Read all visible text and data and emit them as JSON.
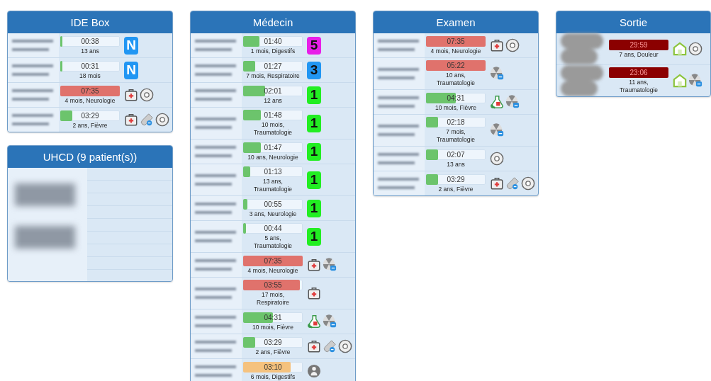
{
  "columns": [
    {
      "panels": [
        {
          "title": "IDE Box",
          "kind": "list",
          "rows": [
            {
              "name": {
                "kind": "blur"
              },
              "timer": {
                "text": "00:38",
                "level": 0.04,
                "color": "#6cc46c"
              },
              "detail": "13 ans",
              "badge": {
                "text": "N",
                "kind": "letter",
                "color": "#2196f3"
              }
            },
            {
              "name": {
                "kind": "blur"
              },
              "timer": {
                "text": "00:31",
                "level": 0.04,
                "color": "#6cc46c"
              },
              "detail": "18 mois",
              "badge": {
                "text": "N",
                "kind": "letter",
                "color": "#2196f3"
              }
            },
            {
              "name": {
                "kind": "blur"
              },
              "timer": {
                "text": "07:35",
                "level": 1,
                "color": "#e0726c"
              },
              "detail": "4 mois, Neurologie",
              "icons": [
                {
                  "kind": "kit"
                },
                {
                  "kind": "disc"
                }
              ]
            },
            {
              "name": {
                "kind": "blur"
              },
              "timer": {
                "text": "03:29",
                "level": 0.2,
                "color": "#6cc46c"
              },
              "detail": "2 ans, Fièvre",
              "icons": [
                {
                  "kind": "kit"
                },
                {
                  "kind": "vial"
                },
                {
                  "kind": "disc"
                }
              ]
            }
          ]
        },
        {
          "title": "UHCD (9 patient(s))",
          "kind": "summary"
        }
      ]
    },
    {
      "panels": [
        {
          "title": "Médecin",
          "kind": "list",
          "rows": [
            {
              "name": {
                "kind": "blur"
              },
              "timer": {
                "text": "01:40",
                "level": 0.27,
                "color": "#6cc46c"
              },
              "detail": "1 mois, Digestifs",
              "badge": {
                "text": "5",
                "kind": "number",
                "color": "#e81ee8"
              }
            },
            {
              "name": {
                "kind": "blur"
              },
              "timer": {
                "text": "01:27",
                "level": 0.2,
                "color": "#6cc46c"
              },
              "detail": "7 mois, Respiratoire",
              "badge": {
                "text": "3",
                "kind": "number",
                "color": "#2196f3"
              }
            },
            {
              "name": {
                "kind": "blur"
              },
              "timer": {
                "text": "02:01",
                "level": 0.37,
                "color": "#6cc46c"
              },
              "detail": "12 ans",
              "badge": {
                "text": "1",
                "kind": "number",
                "color": "#22ee22"
              }
            },
            {
              "name": {
                "kind": "blur"
              },
              "timer": {
                "text": "01:48",
                "level": 0.3,
                "color": "#6cc46c"
              },
              "detail": "10 mois, Traumatologie",
              "badge": {
                "text": "1",
                "kind": "number",
                "color": "#22ee22"
              }
            },
            {
              "name": {
                "kind": "blur"
              },
              "timer": {
                "text": "01:47",
                "level": 0.3,
                "color": "#6cc46c"
              },
              "detail": "10 ans, Neurologie",
              "badge": {
                "text": "1",
                "kind": "number",
                "color": "#22ee22"
              }
            },
            {
              "name": {
                "kind": "blur"
              },
              "timer": {
                "text": "01:13",
                "level": 0.12,
                "color": "#6cc46c"
              },
              "detail": "13 ans, Traumatologie",
              "badge": {
                "text": "1",
                "kind": "number",
                "color": "#22ee22"
              }
            },
            {
              "name": {
                "kind": "blur"
              },
              "timer": {
                "text": "00:55",
                "level": 0.07,
                "color": "#6cc46c"
              },
              "detail": "3 ans, Neurologie",
              "badge": {
                "text": "1",
                "kind": "number",
                "color": "#22ee22"
              }
            },
            {
              "name": {
                "kind": "blur"
              },
              "timer": {
                "text": "00:44",
                "level": 0.05,
                "color": "#6cc46c"
              },
              "detail": "5 ans, Traumatologie",
              "badge": {
                "text": "1",
                "kind": "number",
                "color": "#22ee22"
              }
            },
            {
              "name": {
                "kind": "blur"
              },
              "timer": {
                "text": "07:35",
                "level": 1,
                "color": "#e0726c"
              },
              "detail": "4 mois, Neurologie",
              "icons": [
                {
                  "kind": "kit"
                },
                {
                  "kind": "radiation"
                }
              ]
            },
            {
              "name": {
                "kind": "blur"
              },
              "timer": {
                "text": "03:55",
                "level": 0.95,
                "color": "#e0726c"
              },
              "detail": "17 mois, Respiratoire",
              "icons": [
                {
                  "kind": "kit"
                }
              ]
            },
            {
              "name": {
                "kind": "blur"
              },
              "timer": {
                "text": "04:31",
                "level": 0.5,
                "color": "#6cc46c"
              },
              "detail": "10 mois, Fièvre",
              "icons": [
                {
                  "kind": "rx"
                },
                {
                  "kind": "radiation"
                }
              ]
            },
            {
              "name": {
                "kind": "blur"
              },
              "timer": {
                "text": "03:29",
                "level": 0.2,
                "color": "#6cc46c"
              },
              "detail": "2 ans, Fièvre",
              "icons": [
                {
                  "kind": "kit"
                },
                {
                  "kind": "vial"
                },
                {
                  "kind": "disc"
                }
              ]
            },
            {
              "name": {
                "kind": "blur"
              },
              "timer": {
                "text": "03:10",
                "level": 0.8,
                "color": "#f5c27e"
              },
              "detail": "6 mois, Digestifs",
              "icons": [
                {
                  "kind": "person"
                }
              ]
            }
          ]
        }
      ]
    },
    {
      "panels": [
        {
          "title": "Examen",
          "kind": "list",
          "rows": [
            {
              "name": {
                "kind": "blur"
              },
              "timer": {
                "text": "07:35",
                "level": 1,
                "color": "#e0726c"
              },
              "detail": "4 mois, Neurologie",
              "icons": [
                {
                  "kind": "kit"
                },
                {
                  "kind": "disc"
                }
              ]
            },
            {
              "name": {
                "kind": "blur"
              },
              "timer": {
                "text": "05:22",
                "level": 1,
                "color": "#e0726c"
              },
              "detail": "10 ans, Traumatologie",
              "icons": [
                {
                  "kind": "radiation"
                }
              ]
            },
            {
              "name": {
                "kind": "blur"
              },
              "timer": {
                "text": "04:31",
                "level": 0.5,
                "color": "#6cc46c"
              },
              "detail": "10 mois, Fièvre",
              "icons": [
                {
                  "kind": "rx"
                },
                {
                  "kind": "radiation"
                }
              ]
            },
            {
              "name": {
                "kind": "blur"
              },
              "timer": {
                "text": "02:18",
                "level": 0.2,
                "color": "#6cc46c"
              },
              "detail": "7 mois, Traumatologie",
              "icons": [
                {
                  "kind": "radiation"
                }
              ]
            },
            {
              "name": {
                "kind": "blur"
              },
              "timer": {
                "text": "02:07",
                "level": 0.2,
                "color": "#6cc46c"
              },
              "detail": "13 ans",
              "icons": [
                {
                  "kind": "disc"
                }
              ]
            },
            {
              "name": {
                "kind": "blur"
              },
              "timer": {
                "text": "03:29",
                "level": 0.2,
                "color": "#6cc46c"
              },
              "detail": "2 ans, Fièvre",
              "icons": [
                {
                  "kind": "kit"
                },
                {
                  "kind": "vial"
                },
                {
                  "kind": "disc"
                }
              ]
            }
          ]
        }
      ]
    },
    {
      "panels": [
        {
          "title": "Sortie",
          "kind": "list",
          "rows": [
            {
              "name": {
                "kind": "blob"
              },
              "timer": {
                "text": "29:59",
                "level": 1,
                "color": "#8b0000"
              },
              "detail": "7 ans, Douleur",
              "icons": [
                {
                  "kind": "home"
                },
                {
                  "kind": "disc"
                }
              ]
            },
            {
              "name": {
                "kind": "blob"
              },
              "timer": {
                "text": "23:06",
                "level": 1,
                "color": "#8b0000"
              },
              "detail": "11 ans, Traumatologie",
              "icons": [
                {
                  "kind": "home"
                },
                {
                  "kind": "radiation"
                }
              ]
            }
          ]
        }
      ]
    }
  ]
}
